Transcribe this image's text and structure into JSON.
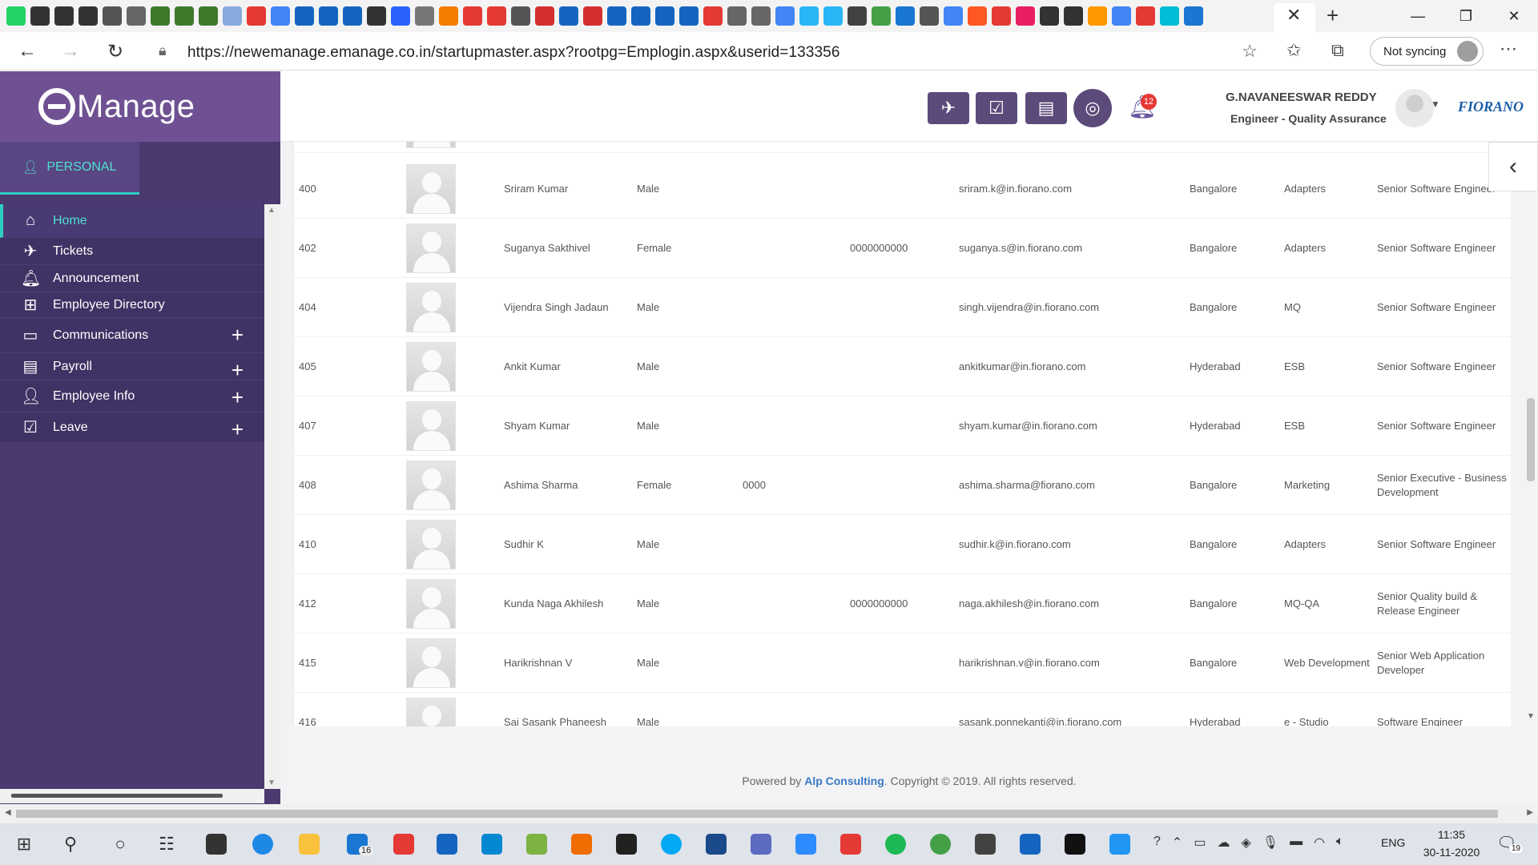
{
  "browser": {
    "url": "https://newemanage.emanage.co.in/startupmaster.aspx?rootpg=Emplogin.aspx&userid=133356",
    "sync_label": "Not syncing",
    "tab_icon_colors": [
      "#25d366",
      "#333",
      "#333",
      "#333",
      "#555",
      "#666",
      "#3d7a2c",
      "#3d7a2c",
      "#3d7a2c",
      "#8ad",
      "#e53935",
      "#4285f4",
      "#1565c0",
      "#1565c0",
      "#1565c0",
      "#333",
      "#2962ff",
      "#777",
      "#f57c00",
      "#e53935",
      "#e53935",
      "#555",
      "#d32f2f",
      "#1565c0",
      "#d32f2f",
      "#1565c0",
      "#1565c0",
      "#1565c0",
      "#1565c0",
      "#e53935",
      "#666",
      "#666",
      "#4285f4",
      "#29b6f6",
      "#29b6f6",
      "#424242",
      "#43a047",
      "#1976d2",
      "#555",
      "#4285f4",
      "#ff5722",
      "#e53935",
      "#e91e63",
      "#333",
      "#333",
      "#ff9800",
      "#4285f4",
      "#e53935",
      "#00bcd4",
      "#1976d2"
    ]
  },
  "header": {
    "logo_text": "Manage",
    "notification_count": "12",
    "user_name": "G.NAVANEESWAR REDDY",
    "user_role": "Engineer - Quality Assurance",
    "company_logo": "FIORANO",
    "accent_color": "#6f5193"
  },
  "sidebar": {
    "section_tab": "PERSONAL",
    "items": [
      {
        "label": "Home",
        "icon": "home-icon",
        "active": true,
        "expandable": false
      },
      {
        "label": "Tickets",
        "icon": "plane-icon",
        "active": false,
        "expandable": false
      },
      {
        "label": "Announcement",
        "icon": "bell-icon",
        "active": false,
        "expandable": false
      },
      {
        "label": "Employee Directory",
        "icon": "org-chart-icon",
        "active": false,
        "expandable": false
      },
      {
        "label": "Communications",
        "icon": "chat-icon",
        "active": false,
        "expandable": true
      },
      {
        "label": "Payroll",
        "icon": "document-icon",
        "active": false,
        "expandable": true
      },
      {
        "label": "Employee Info",
        "icon": "user-info-icon",
        "active": false,
        "expandable": true
      },
      {
        "label": "Leave",
        "icon": "calendar-check-icon",
        "active": false,
        "expandable": true
      }
    ]
  },
  "directory": {
    "rows": [
      {
        "id": "400",
        "name": "Sriram Kumar",
        "gender": "Male",
        "extension": "",
        "mobile": "",
        "email": "sriram.k@in.fiorano.com",
        "location": "Bangalore",
        "department": "Adapters",
        "designation": "Senior Software Engineer"
      },
      {
        "id": "402",
        "name": "Suganya Sakthivel",
        "gender": "Female",
        "extension": "",
        "mobile": "0000000000",
        "email": "suganya.s@in.fiorano.com",
        "location": "Bangalore",
        "department": "Adapters",
        "designation": "Senior Software Engineer"
      },
      {
        "id": "404",
        "name": "Vijendra Singh Jadaun",
        "gender": "Male",
        "extension": "",
        "mobile": "",
        "email": "singh.vijendra@in.fiorano.com",
        "location": "Bangalore",
        "department": "MQ",
        "designation": "Senior Software Engineer"
      },
      {
        "id": "405",
        "name": "Ankit Kumar",
        "gender": "Male",
        "extension": "",
        "mobile": "",
        "email": "ankitkumar@in.fiorano.com",
        "location": "Hyderabad",
        "department": "ESB",
        "designation": "Senior Software Engineer"
      },
      {
        "id": "407",
        "name": "Shyam Kumar",
        "gender": "Male",
        "extension": "",
        "mobile": "",
        "email": "shyam.kumar@in.fiorano.com",
        "location": "Hyderabad",
        "department": "ESB",
        "designation": "Senior Software Engineer"
      },
      {
        "id": "408",
        "name": "Ashima Sharma",
        "gender": "Female",
        "extension": "0000",
        "mobile": "",
        "email": "ashima.sharma@fiorano.com",
        "location": "Bangalore",
        "department": "Marketing",
        "designation": "Senior Executive - Business Development"
      },
      {
        "id": "410",
        "name": "Sudhir K",
        "gender": "Male",
        "extension": "",
        "mobile": "",
        "email": "sudhir.k@in.fiorano.com",
        "location": "Bangalore",
        "department": "Adapters",
        "designation": "Senior Software Engineer"
      },
      {
        "id": "412",
        "name": "Kunda Naga Akhilesh",
        "gender": "Male",
        "extension": "",
        "mobile": "0000000000",
        "email": "naga.akhilesh@in.fiorano.com",
        "location": "Bangalore",
        "department": "MQ-QA",
        "designation": "Senior Quality build & Release Engineer"
      },
      {
        "id": "415",
        "name": "Harikrishnan V",
        "gender": "Male",
        "extension": "",
        "mobile": "",
        "email": "harikrishnan.v@in.fiorano.com",
        "location": "Bangalore",
        "department": "Web Development",
        "designation": "Senior Web Application Developer"
      },
      {
        "id": "416",
        "name": "Sai Sasank Phaneesh",
        "gender": "Male",
        "extension": "",
        "mobile": "",
        "email": "sasank.ponnekanti@in.fiorano.com",
        "location": "Hyderabad",
        "department": "e - Studio",
        "designation": "Software Engineer"
      }
    ]
  },
  "footer": {
    "prefix": "Powered by ",
    "link": "Alp Consulting",
    "suffix": ". Copyright © 2019. All rights reserved."
  },
  "taskbar": {
    "mail_badge": "16",
    "language": "ENG",
    "time": "11:35",
    "date": "30-11-2020",
    "notification_count": "19"
  }
}
